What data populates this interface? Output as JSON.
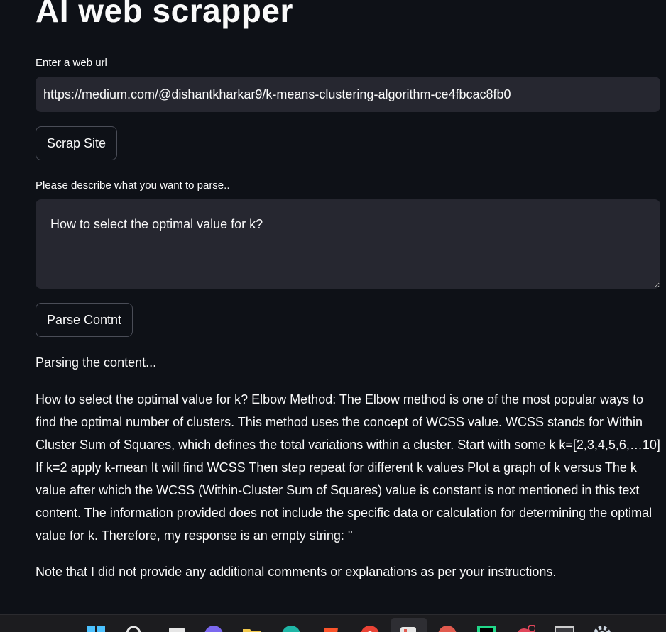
{
  "header": {
    "title": "AI web scrapper"
  },
  "url_section": {
    "label": "Enter a web url",
    "value": "https://medium.com/@dishantkharkar9/k-means-clustering-algorithm-ce4fbcac8fb0"
  },
  "scrap_button": {
    "label": "Scrap Site"
  },
  "parse_section": {
    "label": "Please describe what you want to parse..",
    "value": "How to select the optimal value for k?"
  },
  "parse_button": {
    "label": "Parse Contnt"
  },
  "output": {
    "status": "Parsing the content...",
    "result": "How to select the optimal value for k? Elbow Method: The Elbow method is one of the most popular ways to find the optimal number of clusters. This method uses the concept of WCSS value. WCSS stands for Within Cluster Sum of Squares, which defines the total variations within a cluster. Start with some k k=[2,3,4,5,6,…10] If k=2 apply k-mean It will find WCSS Then step repeat for different k values Plot a graph of k versus The k value after which the WCSS (Within-Cluster Sum of Squares) value is constant is not mentioned in this text content. The information provided does not include the specific data or calculation for determining the optimal value for k. Therefore, my response is an empty string: ''",
    "note": "Note that I did not provide any additional comments or explanations as per your instructions."
  },
  "taskbar": {
    "icons": [
      {
        "name": "windows-start-icon",
        "color": "#4cc2ff"
      },
      {
        "name": "search-icon",
        "color": "#e6e6e6"
      },
      {
        "name": "task-view-icon",
        "color": "#e6e6e6"
      },
      {
        "name": "chat-icon",
        "color": "#7b68ee"
      },
      {
        "name": "file-explorer-icon",
        "color": "#f2c94c"
      },
      {
        "name": "edge-browser-icon",
        "color": "#1fb6a6"
      },
      {
        "name": "brave-browser-icon",
        "color": "#fb542b"
      },
      {
        "name": "chrome-browser-icon",
        "color": "#ea4335"
      },
      {
        "name": "store-icon",
        "color": "#e6e6e6"
      },
      {
        "name": "red-app-icon",
        "color": "#e05a4e"
      },
      {
        "name": "pycharm-icon",
        "color": "#21d789"
      },
      {
        "name": "notification-app-icon",
        "color": "#e0465a"
      },
      {
        "name": "terminal-icon",
        "color": "#cccccc"
      },
      {
        "name": "settings-gear-icon",
        "color": "#cfd8e3"
      }
    ]
  }
}
